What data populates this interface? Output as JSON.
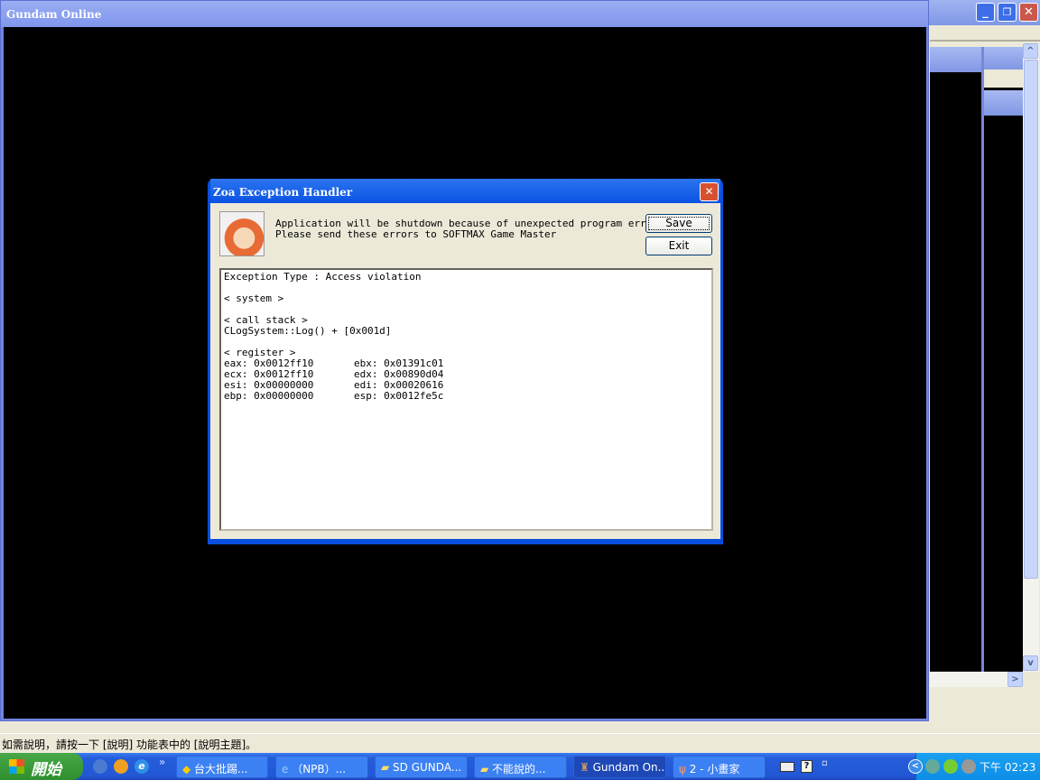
{
  "background_window": {
    "scroll_up": "^",
    "scroll_down": "v",
    "scroll_right": ">"
  },
  "main_window": {
    "title": "Gundam Online",
    "minimize": "_",
    "restore": "❐",
    "close": "✕"
  },
  "status_bar": {
    "text": "如需說明，請按一下 [說明] 功能表中的 [說明主題]。"
  },
  "dialog": {
    "title": "Zoa Exception Handler",
    "close": "✕",
    "message_line1": "Application will be shutdown because of unexpected program error.",
    "message_line2": "Please send these errors to SOFTMAX Game Master",
    "save_label": "Save",
    "exit_label": "Exit",
    "log": {
      "exception": "Exception Type : Access violation",
      "system": "< system >",
      "call_stack_header": "< call stack >",
      "call_stack": "CLogSystem::Log() + [0x001d]",
      "register_header": "< register >",
      "registers": [
        [
          "eax: 0x0012ff10",
          "ebx: 0x01391c01"
        ],
        [
          "ecx: 0x0012ff10",
          "edx: 0x00890d04"
        ],
        [
          "esi: 0x00000000",
          "edi: 0x00020616"
        ],
        [
          "ebp: 0x00000000",
          "esp: 0x0012fe5c"
        ]
      ]
    }
  },
  "taskbar": {
    "start_label": "開始",
    "chevron": "»",
    "tasks": [
      {
        "label": "台大批踢..."
      },
      {
        "label": "（NPB）..."
      },
      {
        "label": "SD GUNDA..."
      },
      {
        "label": "不能說的..."
      },
      {
        "label": "Gundam On..."
      },
      {
        "label": "2 - 小畫家"
      }
    ],
    "help_icon": "?",
    "clock": "下午 02:23",
    "tray_expand": "<"
  }
}
